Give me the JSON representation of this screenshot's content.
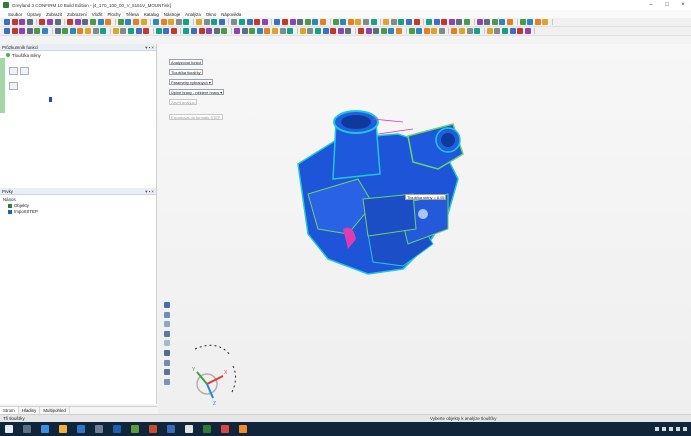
{
  "window": {
    "title": "Greyland 3 CONFIRM 10 Build Edition - [4_170_100_00_V_5151V_MOUNTink]",
    "buttons": [
      "–",
      "□",
      "×"
    ]
  },
  "menu": [
    "Soubor",
    "Úpravy",
    "Zobrazit",
    "Zobrazení",
    "Vložit",
    "Plochy",
    "Tělesa",
    "Katalog",
    "Nástroje",
    "Analýza",
    "Okno",
    "Nápověda"
  ],
  "feature_panel": {
    "title": "Průzkumník funkcí",
    "pin": "▾ ▪ ×",
    "row_label": "Tloušťka stěny"
  },
  "parts_panel": {
    "title": "Prvky",
    "pin": "▾ ▪ ×",
    "root_label": "Nános",
    "nodes": [
      "Objekty",
      "ImportSTEP"
    ]
  },
  "bottom_tabs": [
    "Strom",
    "Hladiny",
    "Multipohled"
  ],
  "viewport": {
    "boxes": {
      "b1": "Analyzovat funkci",
      "b2": "Tloušťka tloušťky",
      "b3": "Parametry vybraných ▾",
      "b4": "Úplné hrany - některé hrany ▾",
      "b5": "Zavřít analýzu",
      "b6": "Exportovat do formátu STEP"
    },
    "tooltip": "Tloušťka stěny = 8.05",
    "axis": {
      "x": "X",
      "y": "Y",
      "z": "Z"
    }
  },
  "status": {
    "left": "Tři tloušťky",
    "middle": "Vyberte objekty k analýze tloušťky"
  },
  "colors": {
    "part_blue": "#1e54d8",
    "part_cyan": "#1fc8d8",
    "highlight_green": "#69d36b",
    "accent_magenta": "#e23bb0"
  }
}
